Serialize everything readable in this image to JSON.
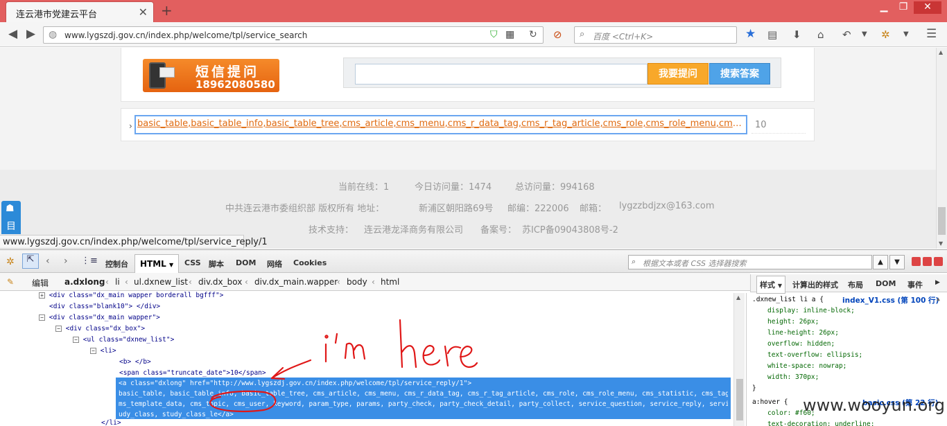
{
  "browser": {
    "tab_title": "连云港市党建云平台",
    "tab_close": "✕",
    "new_tab": "+",
    "url": "www.lygszdj.gov.cn/index.php/welcome/tpl/service_search",
    "search_placeholder": "百度 <Ctrl+K>",
    "status_url": "www.lygszdj.gov.cn/index.php/welcome/tpl/service_reply/1"
  },
  "page": {
    "sms_title": "短信提问",
    "sms_number": "18962080580",
    "ask_button": "我要提问",
    "search_button": "搜索答案",
    "result_link": "basic_table,basic_table_info,basic_table_tree,cms_article,cms_menu,cms_r_data_tag,cms_r_tag_article,cms_role,cms_role_menu,cms_statistic,cms_tag",
    "result_count": "10",
    "footer": {
      "online_label": "当前在线：",
      "online": "1",
      "today_label": "今日访问量：",
      "today": "1474",
      "total_label": "总访问量：",
      "total": "994168",
      "copyright": "中共连云港市委组织部   版权所有   地址：",
      "address": "新浦区朝阳路69号",
      "zip_label": "邮编：",
      "zip": "222006",
      "email_label": "邮箱：",
      "email": "lygzzbdjzx@163.com",
      "support_label": "技术支持：",
      "support": "连云港龙泽商务有限公司",
      "icp_label": "备案号：",
      "icp": "苏ICP备09043808号-2"
    },
    "side_tab": "目"
  },
  "firebug": {
    "tabs": [
      "控制台",
      "HTML",
      "CSS",
      "脚本",
      "DOM",
      "网络",
      "Cookies"
    ],
    "search_placeholder": "根据文本或者 CSS 选择器搜索",
    "edit": "编辑",
    "breadcrumbs": [
      "a.dxlong",
      "li",
      "ul.dxnew_list",
      "div.dx_box",
      "div.dx_main.wapper",
      "body",
      "html"
    ],
    "side_tabs": [
      "样式",
      "计算出的样式",
      "布局",
      "DOM",
      "事件"
    ],
    "html_lines": [
      "<div class=\"dx_main wapper borderall bgfff\">",
      "<div class=\"blank10\"> </div>",
      "<div class=\"dx_main wapper\">",
      "<div class=\"dx_box\">",
      "<ul class=\"dxnew_list\">",
      "<li>",
      "<b> </b>",
      "<span class=\"truncate_date\">10</span>",
      "</li>"
    ],
    "selected_lines": [
      "<a class=\"dxlong\" href=\"http://www.lygszdj.gov.cn/index.php/welcome/tpl/service_reply/1\">",
      "basic_table, basic_table_info, basic_table_tree, cms_article, cms_menu, cms_r_data_tag, cms_r_tag_article, cms_role, cms_role_menu, cms_statistic, cms_tag, cms_template, c",
      "ms_template_data, cms_topic, cms_user, keyword, param_type, params, party_check, party_check_detail, party_collect, service_question, service_reply, service_user_reply, st",
      "udy_class, study_class_le</a>"
    ],
    "css_rule1": {
      "selector": ".dxnew_list li a {",
      "source": "index_V1.css (第 100 行)",
      "props": [
        "display: inline-block;",
        "height: 26px;",
        "line-height: 26px;",
        "overflow: hidden;",
        "text-overflow: ellipsis;",
        "white-space: nowrap;",
        "width: 370px;"
      ],
      "close": "}"
    },
    "css_rule2": {
      "selector": "a:hover {",
      "source": "basic.css (第 22 行)",
      "props": [
        "color: #f60;",
        "text-decoration: underline;"
      ]
    }
  },
  "annotation": "i'm here",
  "watermark": "www.wooyun.org"
}
